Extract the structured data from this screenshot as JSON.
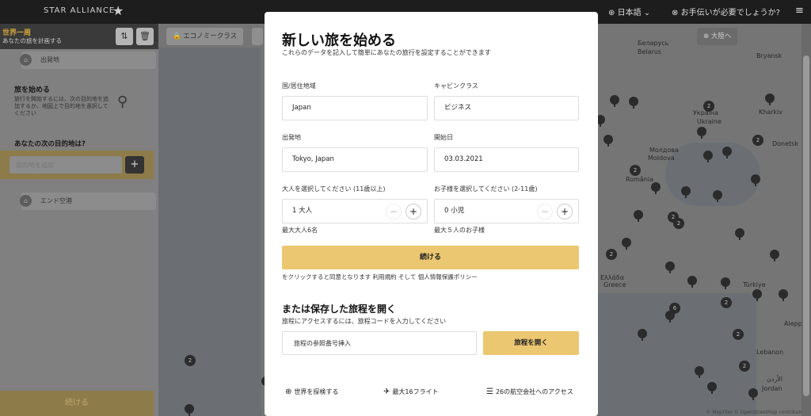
{
  "topbar": {
    "logo": "STAR ALLIANCE",
    "language": "日本語",
    "help": "お手伝いが必要でしょうか?"
  },
  "panel": {
    "title": "世界一周",
    "subtitle": "あなたの旅を計画する",
    "origin_placeholder": "出発地",
    "start_title": "旅を始める",
    "start_desc": "旅行を開始するには、次の目的地を追加するか、地図上で目的地を選択してください",
    "next_title": "あなたの次の目的地は?",
    "destination_placeholder": "目的地を追加",
    "end_placeholder": "エンド空港",
    "continue": "続ける"
  },
  "map": {
    "economy_chip": "エコノミークラス",
    "continent_chip": "大陸へ",
    "attribution": "© MapTiler © OpenStreetMap contributors",
    "labels": {
      "belarus_ru": "Беларусь",
      "belarus": "Belarus",
      "bryansk": "Bryansk",
      "ukraine_ru": "Україна",
      "ukraine": "Ukraine",
      "kharkiv": "Kharkiv",
      "donetsk": "Donetsk",
      "moldova_ro": "Молдова",
      "moldova": "Moldova",
      "romania": "România",
      "greece_gr": "Ελλάδα",
      "greece": "Greece",
      "turkey_tr": "Türkiye",
      "aleppo": "Aleppo",
      "lebanon": "Lebanon",
      "jordan_ar": "الأردن",
      "jordan": "Jordan"
    }
  },
  "modal": {
    "title": "新しい旅を始める",
    "subtitle": "これらのデータを記入して簡単にあなたの旅行を設定することができます",
    "country_label": "国/居住地域",
    "country_value": "Japan",
    "cabin_label": "キャビンクラス",
    "cabin_value": "ビジネス",
    "origin_label": "出発地",
    "origin_value": "Tokyo, Japan",
    "date_label": "開始日",
    "date_value": "03.03.2021",
    "adults_label": "大人を選択してください (11歳以上)",
    "adults_value": "1 大人",
    "adults_note": "最大大人6名",
    "children_label": "お子様を選択してください (2-11歳)",
    "children_value": "0 小児",
    "children_note": "最大５人のお子様",
    "continue": "続ける",
    "terms": "をクリックすると同意となります 利用規約 そして 個人情報保護ポリシー",
    "saved_title": "または保存した旅程を開く",
    "saved_sub": "旅程にアクセスするには、旅程コードを入力してください",
    "ref_placeholder": "旅程の参照番号挿入",
    "open_button": "旅程を開く",
    "features": [
      "世界を探検する",
      "最大16フライト",
      "26の航空会社へのアクセス"
    ]
  }
}
